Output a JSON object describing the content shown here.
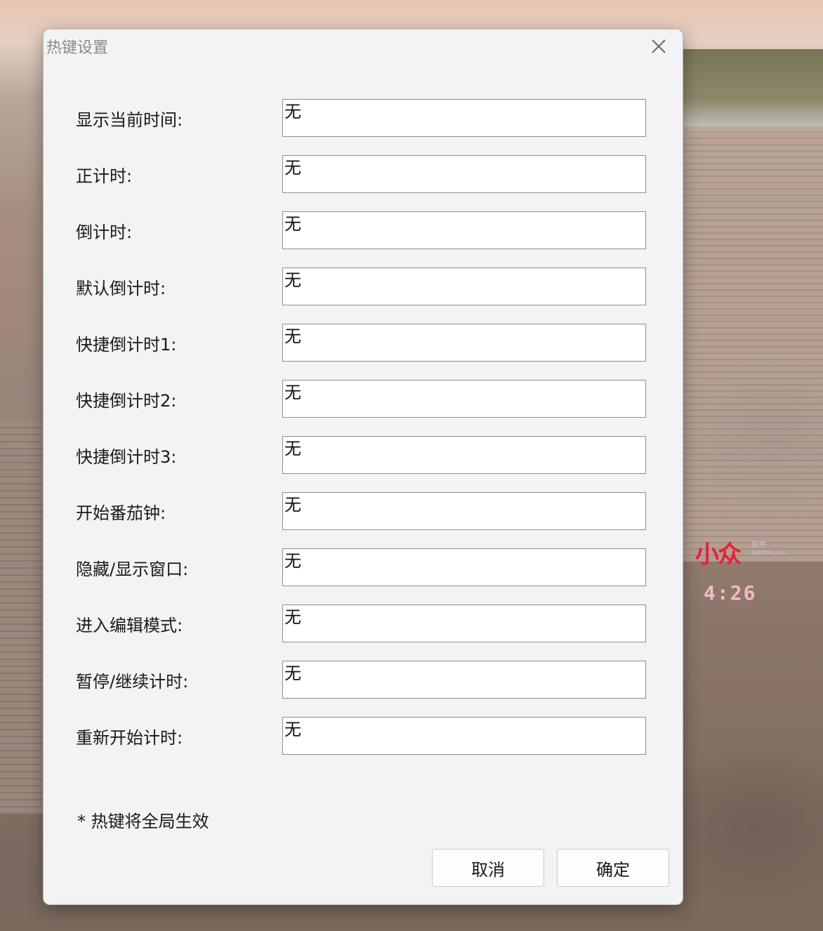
{
  "desktop": {
    "clock_widget": {
      "logo": "小众",
      "logo_sub_1": "软件",
      "logo_sub_2": "APPINN.com",
      "time": "4:26"
    }
  },
  "dialog": {
    "title": "热键设置",
    "close_icon": "close-icon",
    "rows": [
      {
        "label": "显示当前时间:",
        "value": "无"
      },
      {
        "label": "正计时:",
        "value": "无"
      },
      {
        "label": "倒计时:",
        "value": "无"
      },
      {
        "label": "默认倒计时:",
        "value": "无"
      },
      {
        "label": "快捷倒计时1:",
        "value": "无"
      },
      {
        "label": "快捷倒计时2:",
        "value": "无"
      },
      {
        "label": "快捷倒计时3:",
        "value": "无"
      },
      {
        "label": "开始番茄钟:",
        "value": "无"
      },
      {
        "label": "隐藏/显示窗口:",
        "value": "无"
      },
      {
        "label": "进入编辑模式:",
        "value": "无"
      },
      {
        "label": "暂停/继续计时:",
        "value": "无"
      },
      {
        "label": "重新开始计时:",
        "value": "无"
      }
    ],
    "footnote": "* 热键将全局生效",
    "buttons": {
      "cancel": "取消",
      "ok": "确定"
    }
  }
}
